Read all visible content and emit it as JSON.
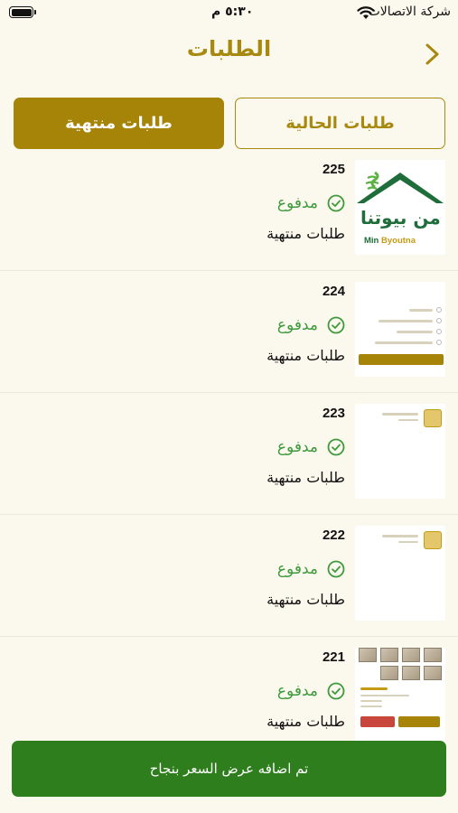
{
  "status_bar": {
    "carrier": "شركة الاتصالات",
    "time": "٥:٣٠ م",
    "icons": [
      "battery-icon",
      "wifi-icon"
    ]
  },
  "header": {
    "title": "الطلبات",
    "back_icon": "chevron-back-icon"
  },
  "tabs": {
    "current_label": "طلبات الحالية",
    "finished_label": "طلبات منتهية",
    "selected": "finished"
  },
  "orders": [
    {
      "number": "225",
      "payment": "مدفوع",
      "status": "طلبات منتهية",
      "thumb": "logo"
    },
    {
      "number": "224",
      "payment": "مدفوع",
      "status": "طلبات منتهية",
      "thumb": "screenshot"
    },
    {
      "number": "223",
      "payment": "مدفوع",
      "status": "طلبات منتهية",
      "thumb": "screenshot"
    },
    {
      "number": "222",
      "payment": "مدفوع",
      "status": "طلبات منتهية",
      "thumb": "screenshot"
    },
    {
      "number": "221",
      "payment": "مدفوع",
      "status": "طلبات منتهية",
      "thumb": "photos"
    }
  ],
  "logo": {
    "arabic": "من بيوتنا",
    "english_1": "Min",
    "english_2": "Byoutna"
  },
  "toast": {
    "message": "تم  اضافه عرض السعر بنجاح"
  },
  "colors": {
    "accent": "#a68408",
    "background": "#fbf9ee",
    "success": "#3e9a3c",
    "toast": "#2f7e1e"
  }
}
